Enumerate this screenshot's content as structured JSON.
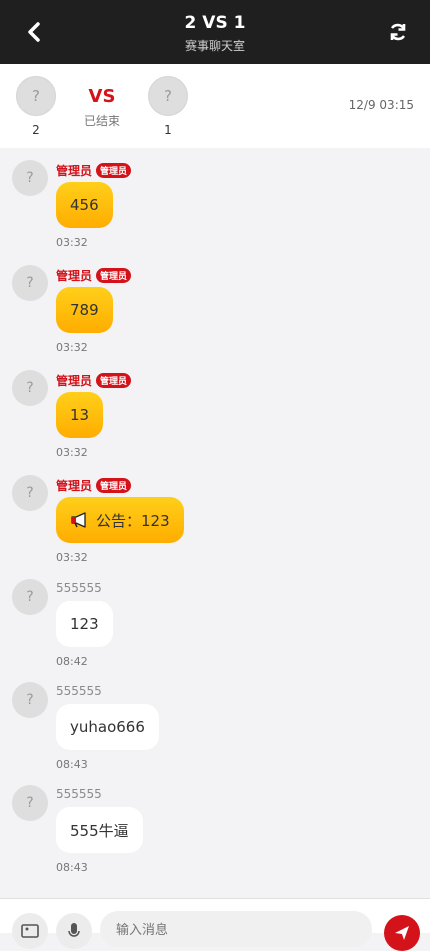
{
  "header": {
    "title": "2 VS 1",
    "subtitle": "赛事聊天室"
  },
  "match": {
    "home": {
      "avatar_glyph": "?",
      "score": "2"
    },
    "away": {
      "avatar_glyph": "?",
      "score": "1"
    },
    "vs_label": "VS",
    "status": "已结束",
    "time": "12/9 03:15"
  },
  "messages": [
    {
      "avatar": "?",
      "name": "管理员",
      "badge": "管理员",
      "text": "456",
      "time": "03:32"
    },
    {
      "avatar": "?",
      "name": "管理员",
      "badge": "管理员",
      "text": "789",
      "time": "03:32"
    },
    {
      "avatar": "?",
      "name": "管理员",
      "badge": "管理员",
      "text": "13",
      "time": "03:32"
    },
    {
      "avatar": "?",
      "name": "管理员",
      "badge": "管理员",
      "text": "公告：123",
      "time": "03:32"
    },
    {
      "avatar": "?",
      "name": "555555",
      "text": "123",
      "time": "08:42"
    },
    {
      "avatar": "?",
      "name": "555555",
      "text": "yuhao666",
      "time": "08:43"
    },
    {
      "avatar": "?",
      "name": "555555",
      "text": "555牛逼",
      "time": "08:43"
    }
  ],
  "input": {
    "placeholder": "输入消息"
  },
  "colors": {
    "accent": "#d3121a",
    "gold": "#ffb800",
    "header_bg": "#1f1f1f"
  }
}
